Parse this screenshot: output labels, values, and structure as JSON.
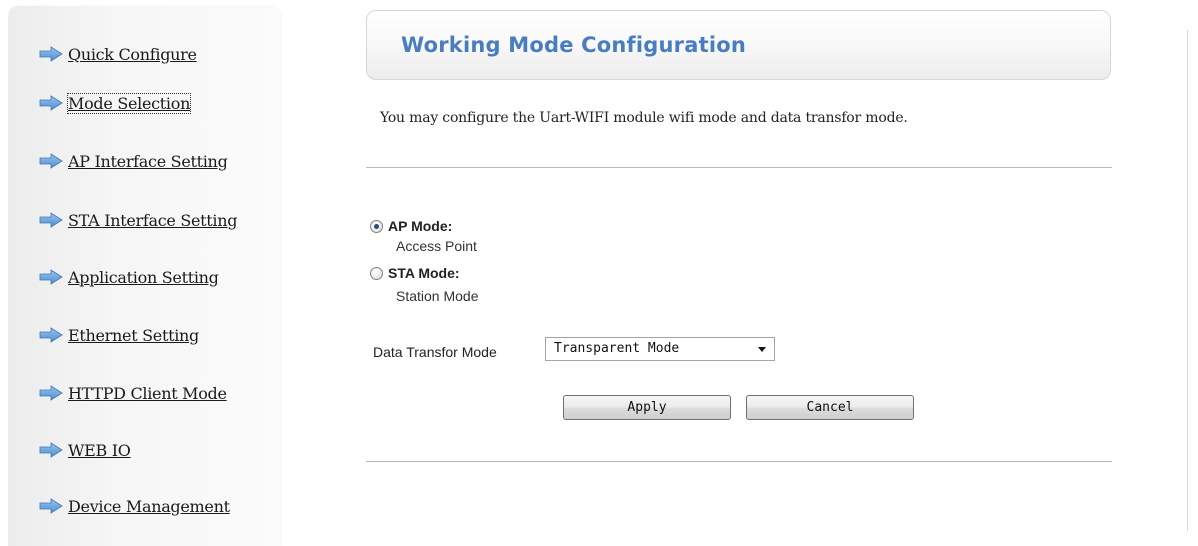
{
  "sidebar": {
    "items": [
      {
        "label": "Quick Configure"
      },
      {
        "label": "Mode Selection"
      },
      {
        "label": "AP Interface Setting"
      },
      {
        "label": "STA Interface Setting"
      },
      {
        "label": "Application Setting"
      },
      {
        "label": "Ethernet Setting"
      },
      {
        "label": "HTTPD Client Mode"
      },
      {
        "label": "WEB IO"
      },
      {
        "label": "Device Management"
      }
    ],
    "arrow_icon": "arrow-right-icon",
    "arrow_color": "#5b9bd5"
  },
  "main": {
    "title": "Working Mode Configuration",
    "intro": "You may configure the Uart-WIFI module wifi mode and data transfor mode.",
    "modes": [
      {
        "label": "AP Mode:",
        "description": "Access Point",
        "checked": true
      },
      {
        "label": "STA Mode:",
        "description": "Station Mode",
        "checked": false
      }
    ],
    "data_transfor": {
      "label": "Data Transfor Mode",
      "selected": "Transparent Mode"
    },
    "buttons": {
      "apply": "Apply",
      "cancel": "Cancel"
    }
  },
  "colors": {
    "title": "#4a7cc0",
    "sidebar_bg": "#f3f3f3"
  }
}
